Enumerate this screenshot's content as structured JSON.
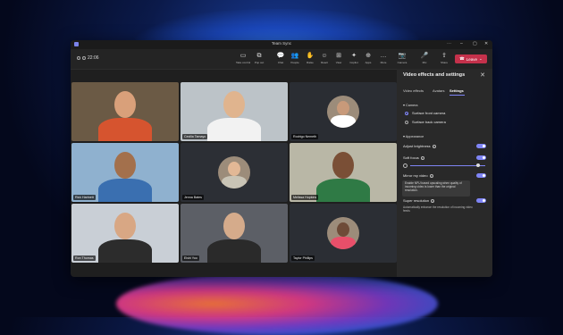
{
  "window": {
    "title": "Team Sync"
  },
  "toolbar": {
    "timer": "22:06",
    "buttons": [
      {
        "icon": "rectangle-icon",
        "glyph": "▭",
        "label": "Take control"
      },
      {
        "icon": "popout-icon",
        "glyph": "⧉",
        "label": "Pop out"
      },
      {
        "icon": "chat-icon",
        "glyph": "💬",
        "label": "Chat"
      },
      {
        "icon": "people-icon",
        "glyph": "👥",
        "label": "People"
      },
      {
        "icon": "raise-hand-icon",
        "glyph": "✋",
        "label": "Raise"
      },
      {
        "icon": "react-icon",
        "glyph": "☺",
        "label": "React"
      },
      {
        "icon": "view-icon",
        "glyph": "⊞",
        "label": "View"
      },
      {
        "icon": "copilot-icon",
        "glyph": "✦",
        "label": "Copilot"
      },
      {
        "icon": "apps-icon",
        "glyph": "⊕",
        "label": "Apps"
      },
      {
        "icon": "more-icon",
        "glyph": "…",
        "label": "More"
      },
      {
        "icon": "camera-icon",
        "glyph": "📷",
        "label": "Camera"
      },
      {
        "icon": "mic-icon",
        "glyph": "🎤",
        "label": "Mic"
      },
      {
        "icon": "share-icon",
        "glyph": "⇪",
        "label": "Share"
      }
    ],
    "leave_label": "Leave"
  },
  "participants": [
    {
      "name": "",
      "bg": "#6b5a45",
      "head": "#d9a07a",
      "body": "#d6542f"
    },
    {
      "name": "Cecilia Tamayo",
      "bg": "#bcc3c8",
      "head": "#e0b48e",
      "body": "#f2f2f2"
    },
    {
      "name": "Rodrigo Nemeth",
      "bg": "#2a2d33",
      "avatar": true,
      "head": "#c89a7a",
      "body": "#ffffff"
    },
    {
      "name": "Rick Hartnett",
      "bg": "#8fb1cf",
      "head": "#a3704c",
      "body": "#3a6fb0"
    },
    {
      "name": "Jenna Bates",
      "bg": "#2c2f35",
      "avatar": true,
      "head": "#e2b896",
      "body": "#c9c4b6"
    },
    {
      "name": "Melissa Hopkins",
      "bg": "#b9b7a6",
      "head": "#7a4f36",
      "body": "#2f7a45"
    },
    {
      "name": "Ron Thomas",
      "bg": "#c9cfd6",
      "head": "#d8a784",
      "body": "#2c2c2c"
    },
    {
      "name": "Eishi Yoo",
      "bg": "#5c5f66",
      "head": "#d5ab8b",
      "body": "#2a2a2a"
    },
    {
      "name": "Taylor Phillips",
      "bg": "#2b2e34",
      "avatar": true,
      "head": "#6e4b38",
      "body": "#e84f6a"
    }
  ],
  "panel": {
    "title": "Video effects and settings",
    "tabs": [
      "Video effects",
      "Avatars",
      "Settings"
    ],
    "active_tab": "Settings",
    "camera": {
      "section": "Camera",
      "options": [
        {
          "label": "Surface front camera",
          "selected": true
        },
        {
          "label": "Surface back camera",
          "selected": false
        }
      ]
    },
    "appearance": {
      "section": "Appearance",
      "adjust_brightness": {
        "label": "Adjust brightness",
        "on": true
      },
      "soft_focus": {
        "label": "Soft focus",
        "on": true,
        "level": 0.9
      },
      "mirror": {
        "label": "Mirror my video",
        "on": true,
        "tooltip": "Enable NPU based upscaling when quality of incoming video is lower than the original resolution."
      },
      "super_resolution": {
        "label": "Super resolution",
        "on": true,
        "description": "Automatically enhance the resolution of incoming video feeds"
      }
    }
  },
  "colors": {
    "accent": "#7f85f5",
    "leave": "#c4314b"
  }
}
